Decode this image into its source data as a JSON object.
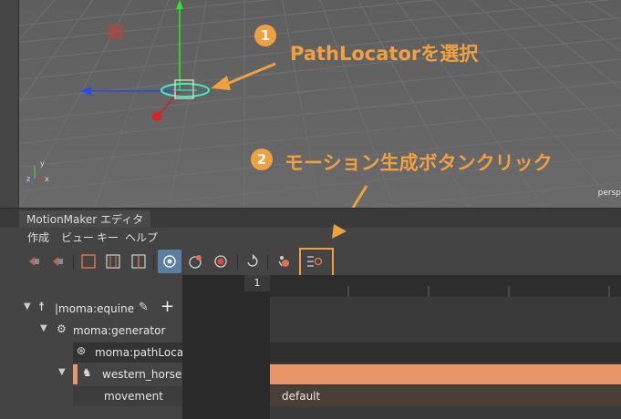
{
  "viewport": {
    "camera_label": "persp",
    "axis_x": "x",
    "axis_y": "y",
    "axis_z": "z"
  },
  "annotations": {
    "step1": {
      "number": "1",
      "text": "PathLocatorを選択"
    },
    "step2": {
      "number": "2",
      "text": "モーション生成ボタンクリック"
    },
    "accent_color": "#f0a040"
  },
  "editor": {
    "tab_label": "MotionMaker エディタ",
    "menu": [
      "作成",
      "ビュー",
      "キー",
      "ヘルプ"
    ],
    "toolbar_icons": [
      "prev-key-icon",
      "next-key-icon",
      "frame-box-icon",
      "frame-split-icon",
      "frame-half-icon",
      "target-icon",
      "horse-icon",
      "record-icon",
      "refresh-icon",
      "character-icon",
      "generate-motion-icon"
    ],
    "frame_marker": "1",
    "outliner": [
      {
        "label": "|moma:equine",
        "expanded": true
      },
      {
        "label": "moma:generator",
        "expanded": true
      },
      {
        "label": "moma:pathLocato"
      },
      {
        "label": "western_horse",
        "expanded": true
      },
      {
        "label": "movement"
      }
    ],
    "track_value": "default",
    "track_color": "#e8956a"
  }
}
